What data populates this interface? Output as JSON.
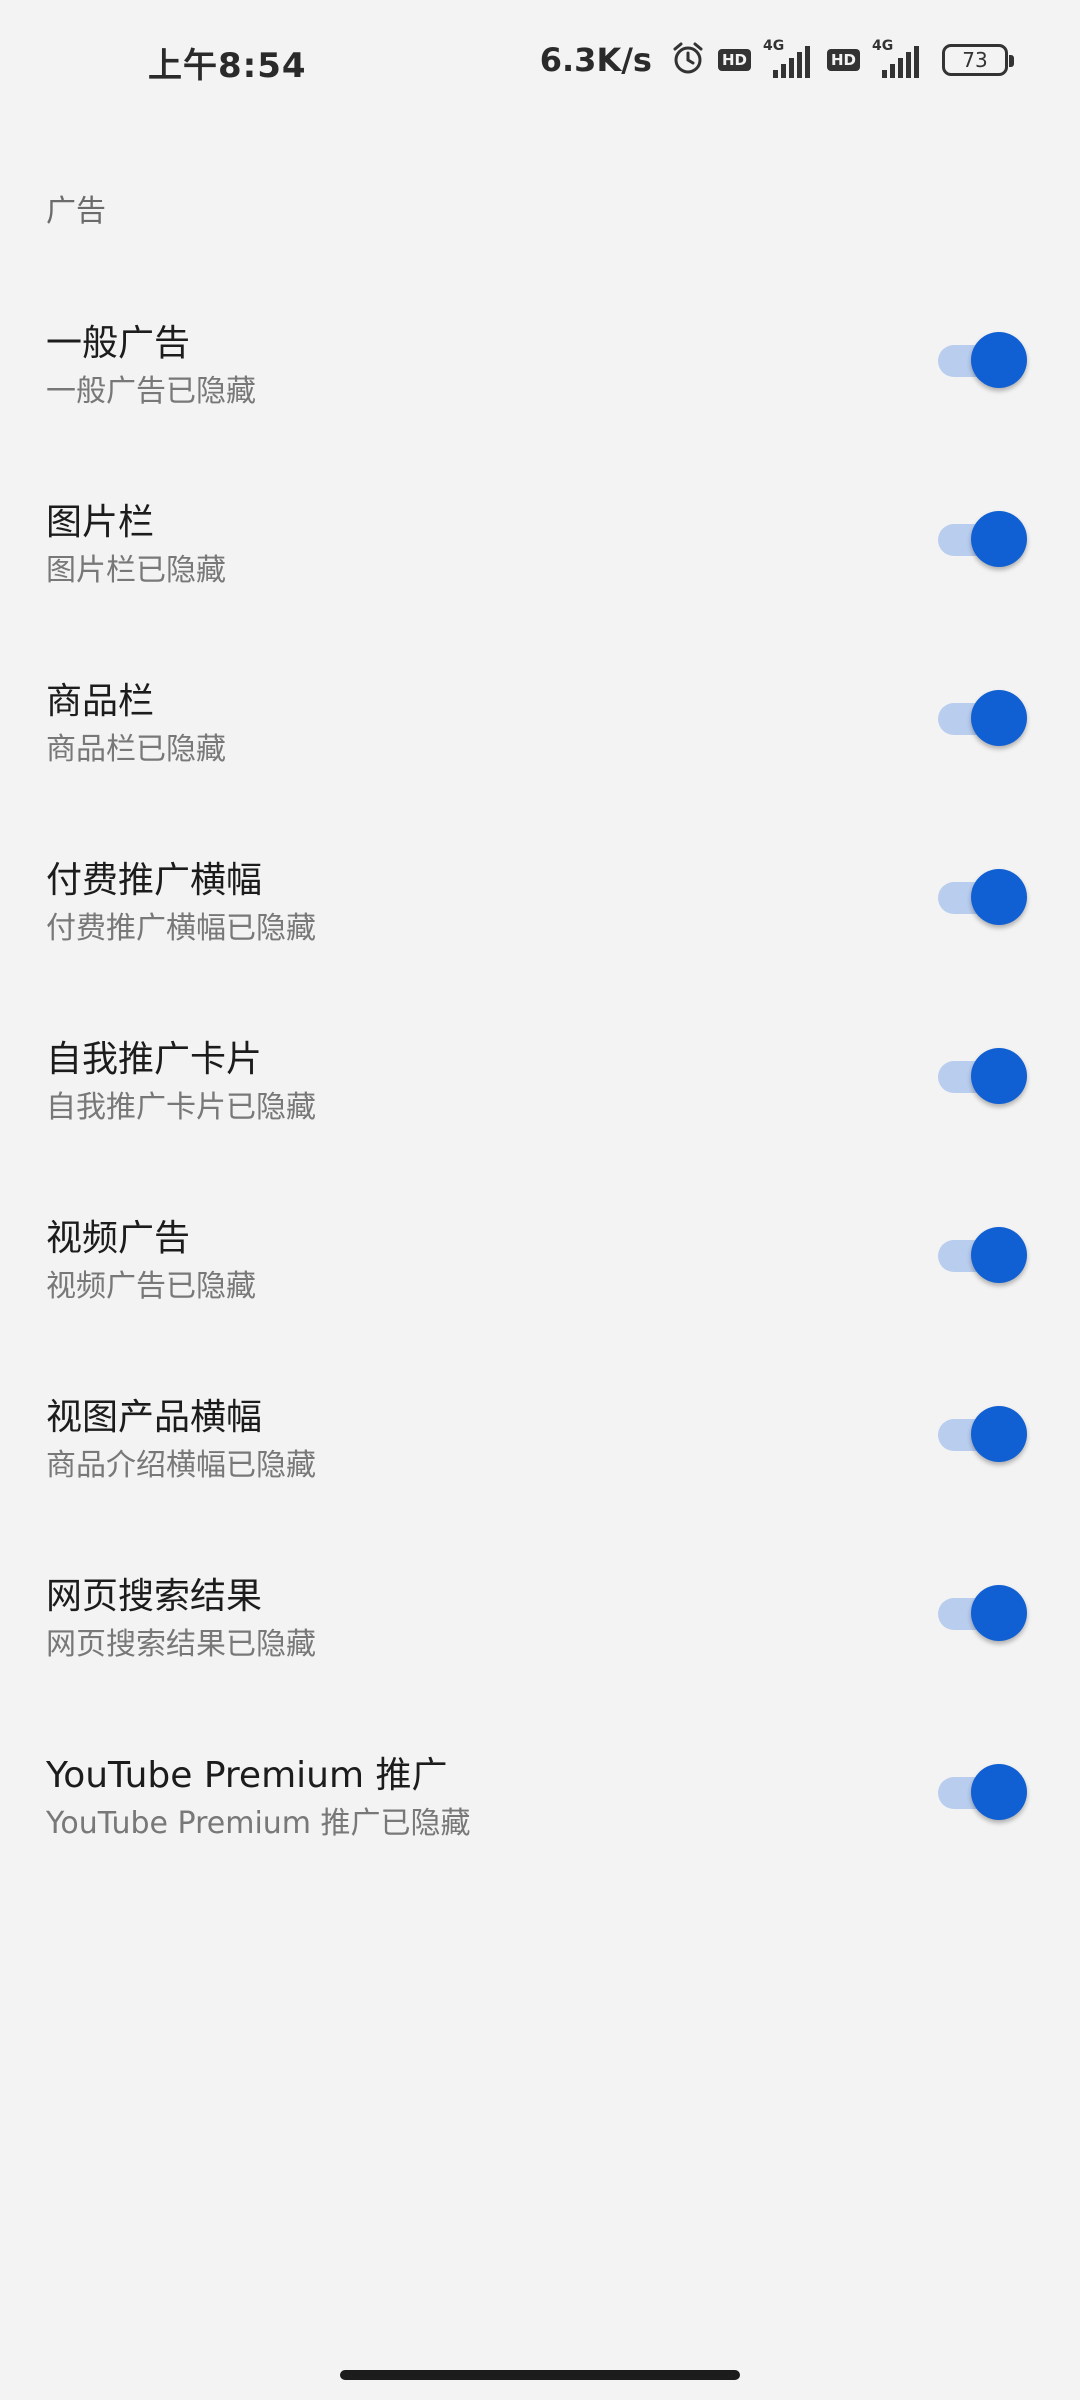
{
  "status_bar": {
    "time": "上午8:54",
    "net_speed": "6.3K/s",
    "hd_label": "HD",
    "lte_label": "4G",
    "battery": "73"
  },
  "section": {
    "title": "广告"
  },
  "settings": [
    {
      "title": "一般广告",
      "summary": "一般广告已隐藏",
      "enabled": true
    },
    {
      "title": "图片栏",
      "summary": "图片栏已隐藏",
      "enabled": true
    },
    {
      "title": "商品栏",
      "summary": "商品栏已隐藏",
      "enabled": true
    },
    {
      "title": "付费推广横幅",
      "summary": "付费推广横幅已隐藏",
      "enabled": true
    },
    {
      "title": "自我推广卡片",
      "summary": "自我推广卡片已隐藏",
      "enabled": true
    },
    {
      "title": "视频广告",
      "summary": "视频广告已隐藏",
      "enabled": true
    },
    {
      "title": "视图产品横幅",
      "summary": "商品介绍横幅已隐藏",
      "enabled": true
    },
    {
      "title": "网页搜索结果",
      "summary": "网页搜索结果已隐藏",
      "enabled": true
    },
    {
      "title": "YouTube Premium 推广",
      "summary": "YouTube Premium 推广已隐藏",
      "enabled": true
    }
  ],
  "colors": {
    "accent": "#1060d4",
    "track": "#b9cdee",
    "background": "#f3f3f3"
  },
  "icons": {
    "alarm": "alarm-clock-icon",
    "signal": "cell-signal-icon",
    "battery": "battery-icon"
  }
}
